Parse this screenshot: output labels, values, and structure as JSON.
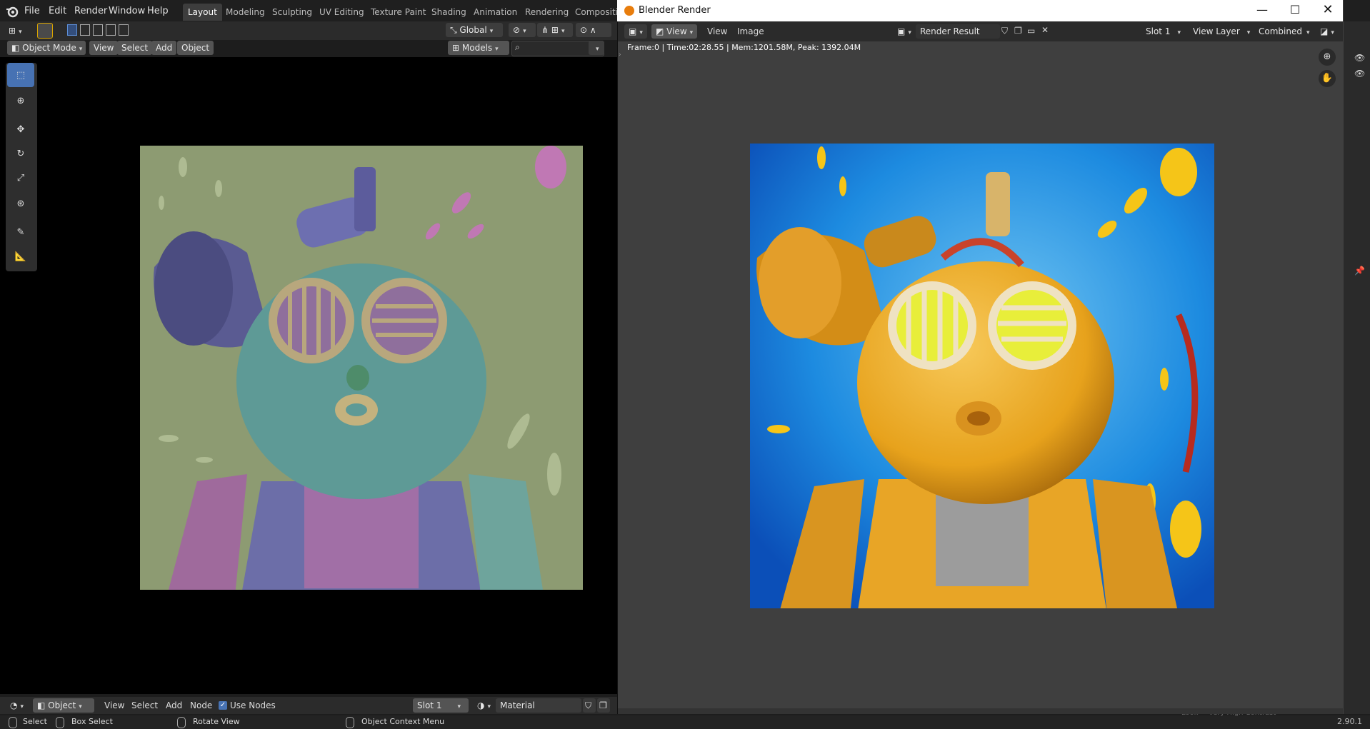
{
  "topbar": {
    "menus": [
      "File",
      "Edit",
      "Render",
      "Window",
      "Help"
    ],
    "workspaces": [
      "Layout",
      "Modeling",
      "Sculpting",
      "UV Editing",
      "Texture Paint",
      "Shading",
      "Animation",
      "Rendering",
      "Compositin"
    ],
    "active_workspace": "Layout",
    "transform_orientation": "Global"
  },
  "viewport": {
    "mode": "Object Mode",
    "menus": [
      "View",
      "Select",
      "Add",
      "Object"
    ],
    "collection": "Models",
    "search_placeholder": ""
  },
  "node_editor": {
    "type": "Object",
    "menus": [
      "View",
      "Select",
      "Add",
      "Node"
    ],
    "use_nodes_label": "Use Nodes",
    "use_nodes_checked": true,
    "slot": "Slot 1",
    "material": "Material"
  },
  "statusbar": {
    "select": "Select",
    "box_select": "Box Select",
    "rotate_view": "Rotate View",
    "context_menu": "Object Context Menu",
    "faded_left": "Look",
    "faded_right": "Very High Contrast",
    "version": "2.90.1"
  },
  "render_window": {
    "title": "Blender Render",
    "menus": [
      "View",
      "View",
      "Image"
    ],
    "image_name": "Render Result",
    "slot": "Slot 1",
    "view_layer": "View Layer",
    "pass": "Combined",
    "info": "Frame:0 | Time:02:28.55 | Mem:1201.58M, Peak: 1392.04M"
  },
  "colors": {
    "viewport_bg": "#6f7c59",
    "render_sky": "#1d8be0",
    "render_gold": "#e7a21c",
    "accent_blue": "#4772b3"
  }
}
